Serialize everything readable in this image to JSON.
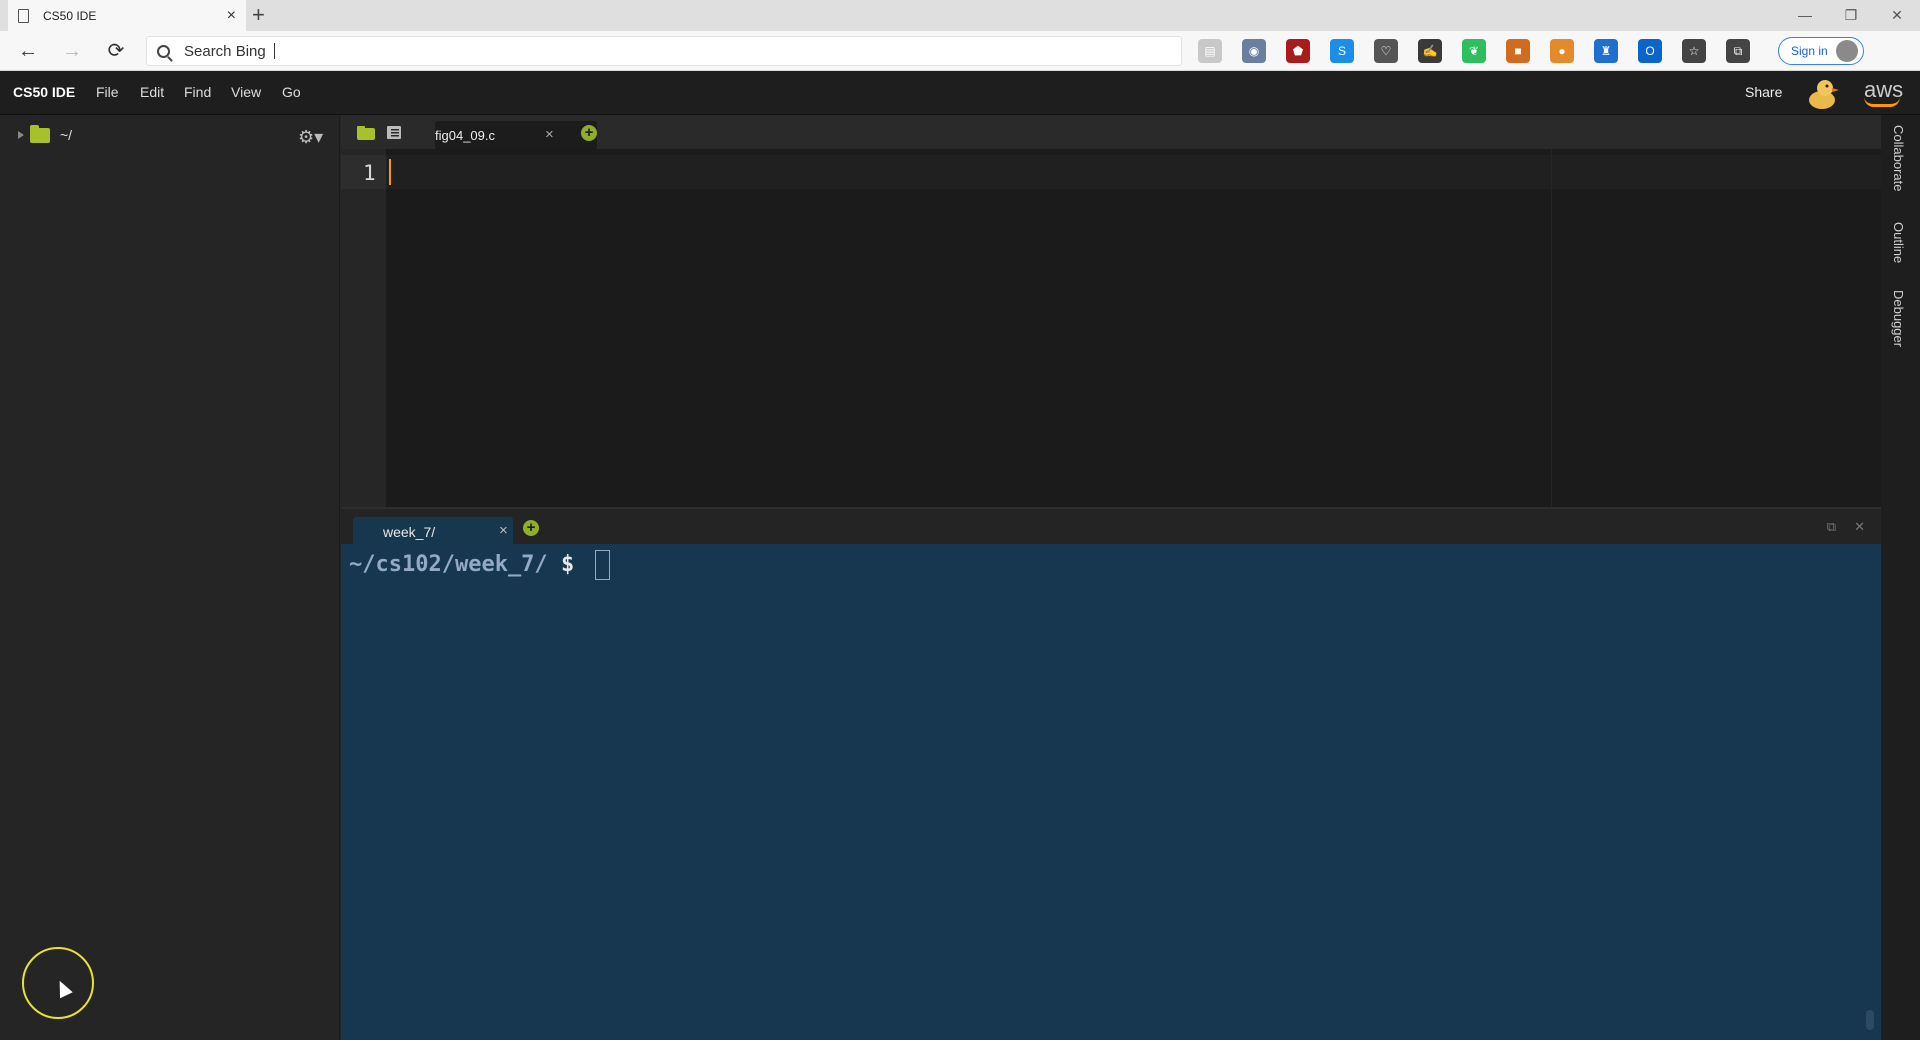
{
  "browser": {
    "tab_title": "CS50 IDE",
    "tab_close": "×",
    "new_tab": "+",
    "window_controls": [
      "—",
      "❐",
      "✕"
    ],
    "nav": {
      "back": "←",
      "forward": "→",
      "refresh": "⟳"
    },
    "address_placeholder": "Search Bing",
    "extensions": [
      {
        "icon": "reader-icon",
        "color": "#c8c8c8",
        "glyph": "▤"
      },
      {
        "icon": "mask-icon",
        "color": "#6a7fa0",
        "glyph": "◉"
      },
      {
        "icon": "ublock-icon",
        "color": "#a81c1c",
        "glyph": "⬟"
      },
      {
        "icon": "skype-icon",
        "color": "#1d8ee8",
        "glyph": "S"
      },
      {
        "icon": "pocket-icon",
        "color": "#555555",
        "glyph": "♡"
      },
      {
        "icon": "signature-icon",
        "color": "#3a3a3a",
        "glyph": "✍"
      },
      {
        "icon": "evernote-icon",
        "color": "#2dbe60",
        "glyph": "❦"
      },
      {
        "icon": "orange-square-icon",
        "color": "#d06b1f",
        "glyph": "■"
      },
      {
        "icon": "cookie-icon",
        "color": "#e38a2a",
        "glyph": "●"
      },
      {
        "icon": "trophy-icon",
        "color": "#1f6fd1",
        "glyph": "♜"
      },
      {
        "icon": "outlook-icon",
        "color": "#0a64c9",
        "glyph": "O"
      },
      {
        "icon": "favorites-icon",
        "color": "#444444",
        "glyph": "☆"
      },
      {
        "icon": "collections-icon",
        "color": "#444444",
        "glyph": "⧉"
      }
    ],
    "signin_label": "Sign in",
    "more": "···"
  },
  "ide": {
    "brand": "CS50 IDE",
    "menu": [
      "File",
      "Edit",
      "Find",
      "View",
      "Go"
    ],
    "share": "Share",
    "aws": "aws"
  },
  "sidebar": {
    "root_label": "~/"
  },
  "editor": {
    "tab_label": "fig04_09.c",
    "tab_close": "×",
    "add": "+",
    "line_number": "1"
  },
  "terminal": {
    "tab_label": "week_7/",
    "tab_close": "×",
    "add": "+",
    "prompt_path": "~/cs102/week_7/",
    "prompt_symbol": "$"
  },
  "rail": [
    "Collaborate",
    "Outline",
    "Debugger"
  ]
}
